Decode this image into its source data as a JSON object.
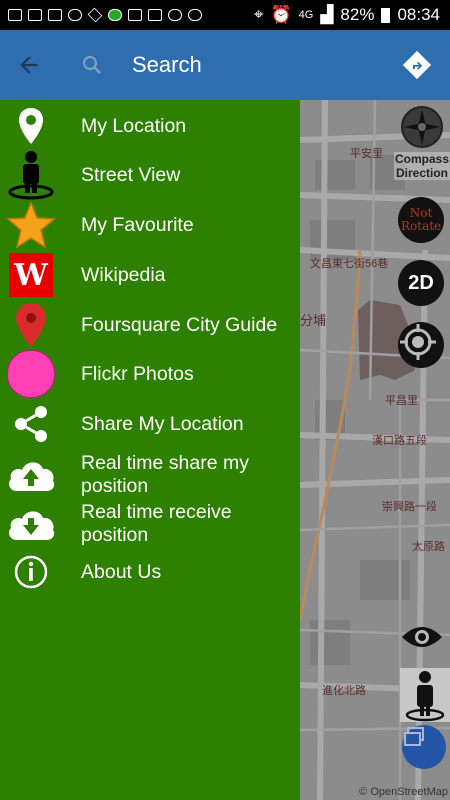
{
  "status_bar": {
    "network": "4G",
    "battery": "82%",
    "time": "08:34"
  },
  "appbar": {
    "title": "Search",
    "back_icon": "arrow-back-icon",
    "search_icon": "search-icon",
    "directions_icon": "directions-icon"
  },
  "drawer": {
    "items": [
      {
        "label": "My Location",
        "icon": "location-pin-icon"
      },
      {
        "label": "Street View",
        "icon": "street-view-person-icon"
      },
      {
        "label": "My Favourite",
        "icon": "star-icon"
      },
      {
        "label": "Wikipedia",
        "icon": "wikipedia-icon"
      },
      {
        "label": "Foursquare City Guide",
        "icon": "red-map-pin-icon"
      },
      {
        "label": "Flickr Photos",
        "icon": "pink-circle-icon"
      },
      {
        "label": "Share My Location",
        "icon": "share-icon"
      },
      {
        "label": "Real time share my position",
        "icon": "cloud-upload-icon"
      },
      {
        "label": "Real time receive position",
        "icon": "cloud-download-icon"
      },
      {
        "label": "About Us",
        "icon": "info-icon"
      }
    ]
  },
  "map": {
    "compass_label": "Compass Direction",
    "not_rotate_label": "Not Rotate",
    "mode_label": "2D",
    "attribution": "© OpenStreetMap",
    "labels": {
      "l1": "平安里",
      "l2": "文昌東七街56巷",
      "l3": "分埔",
      "l4": "平昌里",
      "l5": "漢口路五段",
      "l6": "崇興路一段",
      "l7": "太原路",
      "l8": "進化北路"
    },
    "colors": {
      "drawer": "#2e8000",
      "appbar": "#2f6eae"
    }
  }
}
